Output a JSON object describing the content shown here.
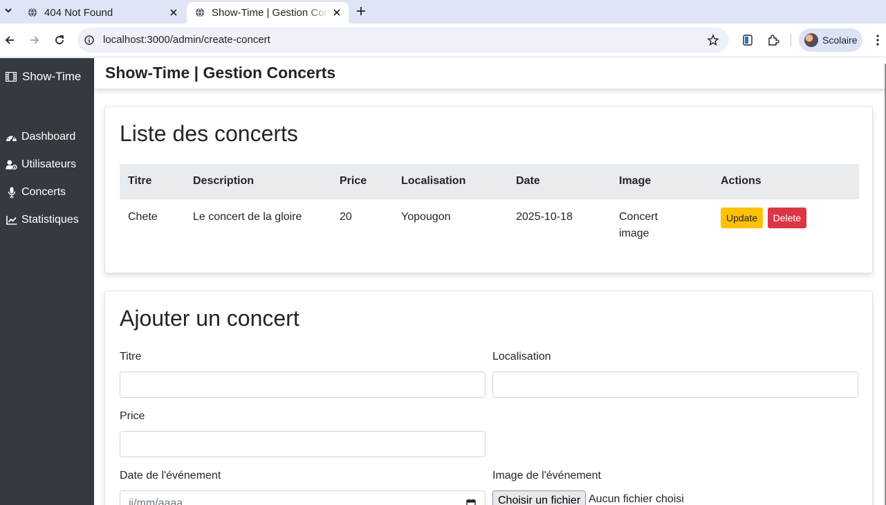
{
  "browser": {
    "tabs": [
      {
        "title": "404 Not Found",
        "active": false
      },
      {
        "title": "Show-Time | Gestion Concerts",
        "active": true
      }
    ],
    "url": "localhost:3000/admin/create-concert",
    "profile_name": "Scolaire"
  },
  "sidebar": {
    "brand": "Show-Time",
    "items": [
      {
        "label": "Dashboard",
        "icon": "gauge-icon"
      },
      {
        "label": "Utilisateurs",
        "icon": "user-cog-icon"
      },
      {
        "label": "Concerts",
        "icon": "microphone-icon"
      },
      {
        "label": "Statistiques",
        "icon": "line-chart-icon"
      }
    ]
  },
  "header": {
    "title": "Show-Time | Gestion Concerts"
  },
  "list": {
    "title": "Liste des concerts",
    "columns": [
      "Titre",
      "Description",
      "Price",
      "Localisation",
      "Date",
      "Image",
      "Actions"
    ],
    "rows": [
      {
        "titre": "Chete",
        "description": "Le concert de la gloire",
        "price": "20",
        "localisation": "Yopougon",
        "date": "2025-10-18",
        "image_alt": "Concert image",
        "update_label": "Update",
        "delete_label": "Delete"
      }
    ]
  },
  "form": {
    "title": "Ajouter un concert",
    "titre_label": "Titre",
    "titre_value": "",
    "localisation_label": "Localisation",
    "localisation_value": "",
    "price_label": "Price",
    "price_value": "",
    "date_label": "Date de l'événement",
    "date_placeholder": "jj/mm/aaaa",
    "image_label": "Image de l'événement",
    "file_button": "Choisir un fichier",
    "file_status": "Aucun fichier choisi"
  },
  "colors": {
    "sidebar_bg": "#343a40",
    "btn_update": "#ffc107",
    "btn_delete": "#dc3545",
    "table_head_bg": "#e9ecef"
  }
}
